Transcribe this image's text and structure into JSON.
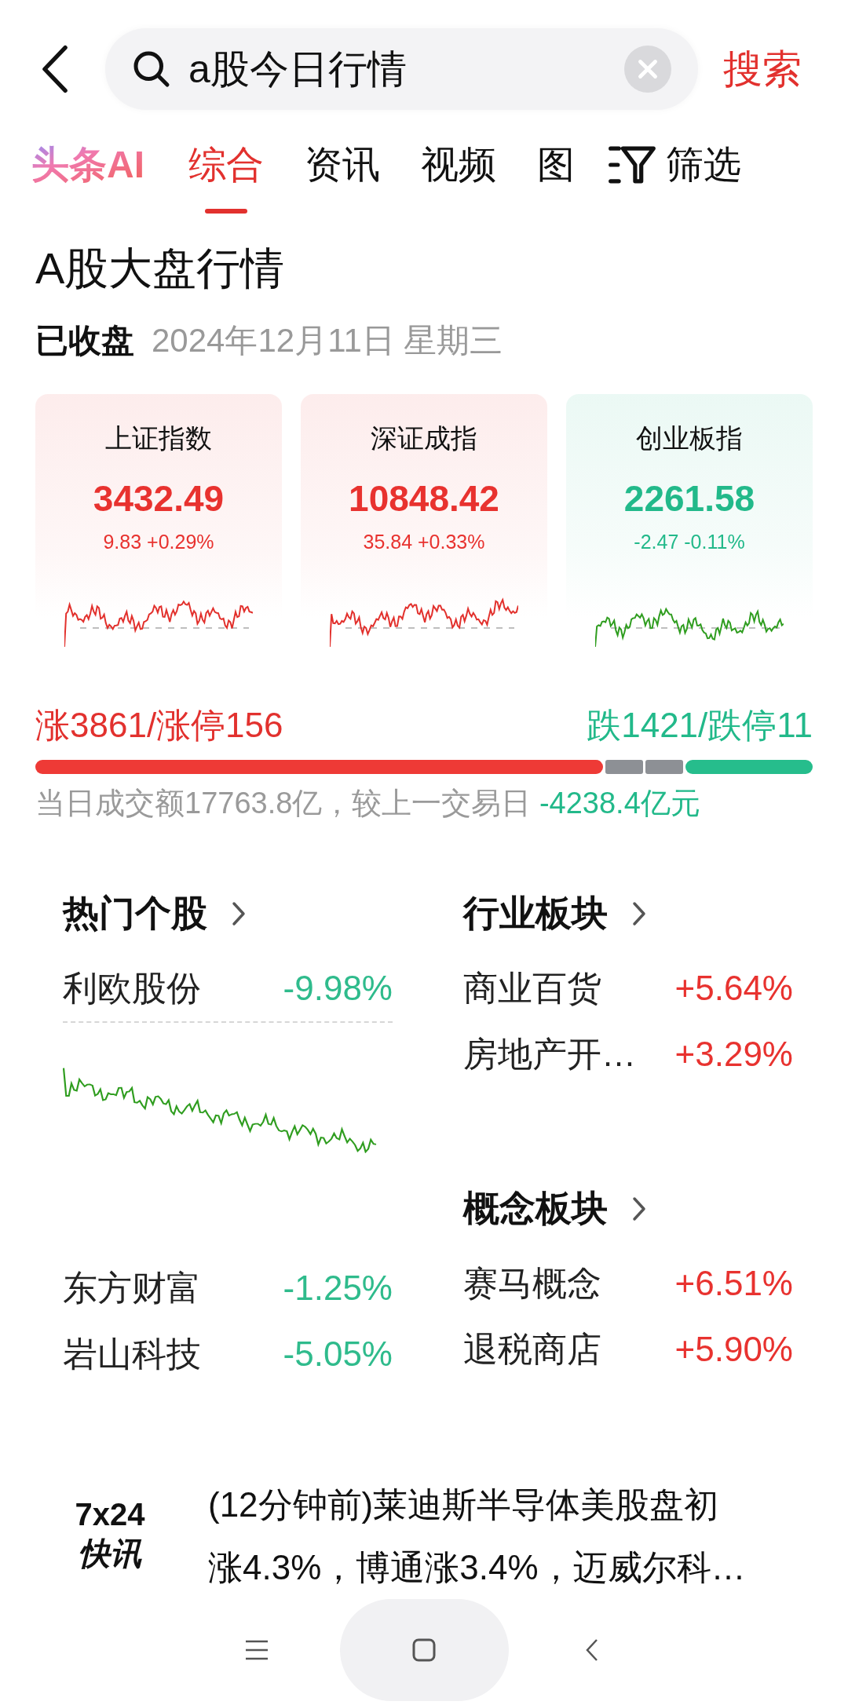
{
  "header": {
    "search": {
      "value": "a股今日行情"
    },
    "search_button": "搜索"
  },
  "ai_button": {
    "label": "头条AI"
  },
  "tabs": [
    {
      "label": "综合",
      "kind": "text",
      "selected": true
    },
    {
      "label": "资讯",
      "kind": "text",
      "selected": false
    },
    {
      "label": "视频",
      "kind": "text",
      "selected": false
    },
    {
      "label": "图",
      "kind": "text",
      "selected": false
    },
    {
      "label": "筛选",
      "kind": "filter",
      "selected": false
    }
  ],
  "market": {
    "title": "A股大盘行情",
    "status": "已收盘",
    "date": "2024年12月11日 星期三",
    "indices": [
      {
        "name": "上证指数",
        "value": "3432.49",
        "change": "9.83 +0.29%",
        "color": "#e8322f"
      },
      {
        "name": "深证成指",
        "value": "10848.42",
        "change": "35.84 +0.33%",
        "color": "#e8322f"
      },
      {
        "name": "创业板指",
        "value": "2261.58",
        "change": "-2.47 -0.11%",
        "color": "#22b98a"
      }
    ],
    "breadth": {
      "up": "涨3861/涨停156",
      "down": "跌1421/跌停11"
    },
    "turnover": {
      "text": "当日成交额17763.8亿，较上一交易日 ",
      "diff": "-4238.4亿元",
      "color": "#22b98a"
    }
  },
  "hot_stocks": {
    "title": "热门个股",
    "items": [
      {
        "name": "利欧股份",
        "change": "-9.98%",
        "color": "#2fbb8c",
        "expanded": true
      },
      {
        "name": "东方财富",
        "change": "-1.25%",
        "color": "#2fbb8c",
        "expanded": false
      },
      {
        "name": "岩山科技",
        "change": "-5.05%",
        "color": "#2fbb8c",
        "expanded": false
      }
    ]
  },
  "sectors": [
    {
      "title": "行业板块",
      "items": [
        {
          "name": "商业百货",
          "change": "+5.64%",
          "color": "#e8322f"
        },
        {
          "name": "房地产开…",
          "change": "+3.29%",
          "color": "#e8322f"
        }
      ]
    },
    {
      "title": "概念板块",
      "items": [
        {
          "name": "赛马概念",
          "change": "+6.51%",
          "color": "#e8322f"
        },
        {
          "name": "退税商店",
          "change": "+5.90%",
          "color": "#e8322f"
        }
      ]
    }
  ],
  "news": {
    "logo_top": "7x24",
    "logo_bottom": "快讯",
    "text": "(12分钟前)莱迪斯半导体美股盘初涨4.3%，博通涨3.4%，迈威尔科…"
  }
}
